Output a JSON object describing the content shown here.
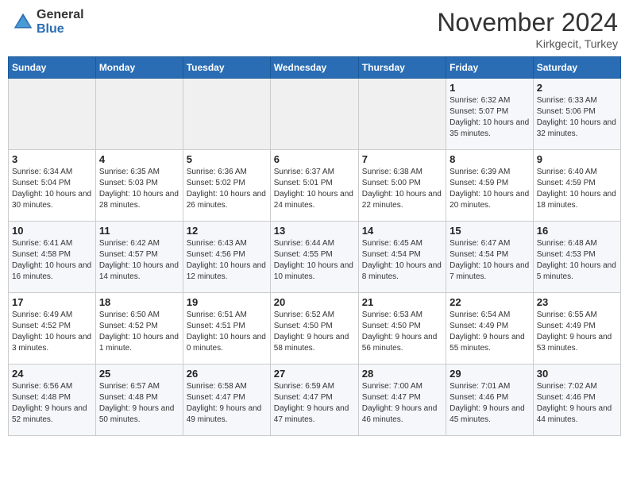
{
  "header": {
    "logo_general": "General",
    "logo_blue": "Blue",
    "month": "November 2024",
    "location": "Kirkgecit, Turkey"
  },
  "days_of_week": [
    "Sunday",
    "Monday",
    "Tuesday",
    "Wednesday",
    "Thursday",
    "Friday",
    "Saturday"
  ],
  "weeks": [
    [
      {
        "day": "",
        "empty": true
      },
      {
        "day": "",
        "empty": true
      },
      {
        "day": "",
        "empty": true
      },
      {
        "day": "",
        "empty": true
      },
      {
        "day": "",
        "empty": true
      },
      {
        "day": "1",
        "sunrise": "Sunrise: 6:32 AM",
        "sunset": "Sunset: 5:07 PM",
        "daylight": "Daylight: 10 hours and 35 minutes."
      },
      {
        "day": "2",
        "sunrise": "Sunrise: 6:33 AM",
        "sunset": "Sunset: 5:06 PM",
        "daylight": "Daylight: 10 hours and 32 minutes."
      }
    ],
    [
      {
        "day": "3",
        "sunrise": "Sunrise: 6:34 AM",
        "sunset": "Sunset: 5:04 PM",
        "daylight": "Daylight: 10 hours and 30 minutes."
      },
      {
        "day": "4",
        "sunrise": "Sunrise: 6:35 AM",
        "sunset": "Sunset: 5:03 PM",
        "daylight": "Daylight: 10 hours and 28 minutes."
      },
      {
        "day": "5",
        "sunrise": "Sunrise: 6:36 AM",
        "sunset": "Sunset: 5:02 PM",
        "daylight": "Daylight: 10 hours and 26 minutes."
      },
      {
        "day": "6",
        "sunrise": "Sunrise: 6:37 AM",
        "sunset": "Sunset: 5:01 PM",
        "daylight": "Daylight: 10 hours and 24 minutes."
      },
      {
        "day": "7",
        "sunrise": "Sunrise: 6:38 AM",
        "sunset": "Sunset: 5:00 PM",
        "daylight": "Daylight: 10 hours and 22 minutes."
      },
      {
        "day": "8",
        "sunrise": "Sunrise: 6:39 AM",
        "sunset": "Sunset: 4:59 PM",
        "daylight": "Daylight: 10 hours and 20 minutes."
      },
      {
        "day": "9",
        "sunrise": "Sunrise: 6:40 AM",
        "sunset": "Sunset: 4:59 PM",
        "daylight": "Daylight: 10 hours and 18 minutes."
      }
    ],
    [
      {
        "day": "10",
        "sunrise": "Sunrise: 6:41 AM",
        "sunset": "Sunset: 4:58 PM",
        "daylight": "Daylight: 10 hours and 16 minutes."
      },
      {
        "day": "11",
        "sunrise": "Sunrise: 6:42 AM",
        "sunset": "Sunset: 4:57 PM",
        "daylight": "Daylight: 10 hours and 14 minutes."
      },
      {
        "day": "12",
        "sunrise": "Sunrise: 6:43 AM",
        "sunset": "Sunset: 4:56 PM",
        "daylight": "Daylight: 10 hours and 12 minutes."
      },
      {
        "day": "13",
        "sunrise": "Sunrise: 6:44 AM",
        "sunset": "Sunset: 4:55 PM",
        "daylight": "Daylight: 10 hours and 10 minutes."
      },
      {
        "day": "14",
        "sunrise": "Sunrise: 6:45 AM",
        "sunset": "Sunset: 4:54 PM",
        "daylight": "Daylight: 10 hours and 8 minutes."
      },
      {
        "day": "15",
        "sunrise": "Sunrise: 6:47 AM",
        "sunset": "Sunset: 4:54 PM",
        "daylight": "Daylight: 10 hours and 7 minutes."
      },
      {
        "day": "16",
        "sunrise": "Sunrise: 6:48 AM",
        "sunset": "Sunset: 4:53 PM",
        "daylight": "Daylight: 10 hours and 5 minutes."
      }
    ],
    [
      {
        "day": "17",
        "sunrise": "Sunrise: 6:49 AM",
        "sunset": "Sunset: 4:52 PM",
        "daylight": "Daylight: 10 hours and 3 minutes."
      },
      {
        "day": "18",
        "sunrise": "Sunrise: 6:50 AM",
        "sunset": "Sunset: 4:52 PM",
        "daylight": "Daylight: 10 hours and 1 minute."
      },
      {
        "day": "19",
        "sunrise": "Sunrise: 6:51 AM",
        "sunset": "Sunset: 4:51 PM",
        "daylight": "Daylight: 10 hours and 0 minutes."
      },
      {
        "day": "20",
        "sunrise": "Sunrise: 6:52 AM",
        "sunset": "Sunset: 4:50 PM",
        "daylight": "Daylight: 9 hours and 58 minutes."
      },
      {
        "day": "21",
        "sunrise": "Sunrise: 6:53 AM",
        "sunset": "Sunset: 4:50 PM",
        "daylight": "Daylight: 9 hours and 56 minutes."
      },
      {
        "day": "22",
        "sunrise": "Sunrise: 6:54 AM",
        "sunset": "Sunset: 4:49 PM",
        "daylight": "Daylight: 9 hours and 55 minutes."
      },
      {
        "day": "23",
        "sunrise": "Sunrise: 6:55 AM",
        "sunset": "Sunset: 4:49 PM",
        "daylight": "Daylight: 9 hours and 53 minutes."
      }
    ],
    [
      {
        "day": "24",
        "sunrise": "Sunrise: 6:56 AM",
        "sunset": "Sunset: 4:48 PM",
        "daylight": "Daylight: 9 hours and 52 minutes."
      },
      {
        "day": "25",
        "sunrise": "Sunrise: 6:57 AM",
        "sunset": "Sunset: 4:48 PM",
        "daylight": "Daylight: 9 hours and 50 minutes."
      },
      {
        "day": "26",
        "sunrise": "Sunrise: 6:58 AM",
        "sunset": "Sunset: 4:47 PM",
        "daylight": "Daylight: 9 hours and 49 minutes."
      },
      {
        "day": "27",
        "sunrise": "Sunrise: 6:59 AM",
        "sunset": "Sunset: 4:47 PM",
        "daylight": "Daylight: 9 hours and 47 minutes."
      },
      {
        "day": "28",
        "sunrise": "Sunrise: 7:00 AM",
        "sunset": "Sunset: 4:47 PM",
        "daylight": "Daylight: 9 hours and 46 minutes."
      },
      {
        "day": "29",
        "sunrise": "Sunrise: 7:01 AM",
        "sunset": "Sunset: 4:46 PM",
        "daylight": "Daylight: 9 hours and 45 minutes."
      },
      {
        "day": "30",
        "sunrise": "Sunrise: 7:02 AM",
        "sunset": "Sunset: 4:46 PM",
        "daylight": "Daylight: 9 hours and 44 minutes."
      }
    ]
  ]
}
